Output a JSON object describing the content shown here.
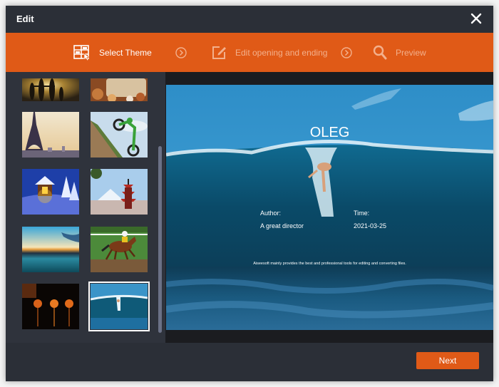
{
  "window": {
    "title": "Edit",
    "close_icon": "close-icon"
  },
  "steps": [
    {
      "label": "Select Theme",
      "icon": "theme-grid-icon",
      "state": "active"
    },
    {
      "label": "Edit opening and ending",
      "icon": "edit-icon",
      "state": "inactive"
    },
    {
      "label": "Preview",
      "icon": "search-icon",
      "state": "inactive"
    }
  ],
  "step_separator_icon": "chevron-right-circle-icon",
  "themes": [
    {
      "name": "family-sunset",
      "selected": false
    },
    {
      "name": "holiday-cookies",
      "selected": false
    },
    {
      "name": "eiffel-tower",
      "selected": false
    },
    {
      "name": "motocross",
      "selected": false
    },
    {
      "name": "snowy-cabin",
      "selected": false
    },
    {
      "name": "japanese-pagoda",
      "selected": false
    },
    {
      "name": "lake-sunset",
      "selected": false
    },
    {
      "name": "horse-racing",
      "selected": false
    },
    {
      "name": "halloween-pumpkins",
      "selected": false
    },
    {
      "name": "surfing-wave",
      "selected": true
    }
  ],
  "preview": {
    "title": "OLEG",
    "author_label": "Author:",
    "author_value": "A great director",
    "time_label": "Time:",
    "time_value": "2021-03-25",
    "tagline": "Aiseesoft mainly provides the best and professional tools for editing and converting files."
  },
  "footer": {
    "next_label": "Next"
  },
  "colors": {
    "accent": "#e05a17",
    "window_bg": "#2b2f37",
    "sidebar_bg": "#2f333c"
  }
}
